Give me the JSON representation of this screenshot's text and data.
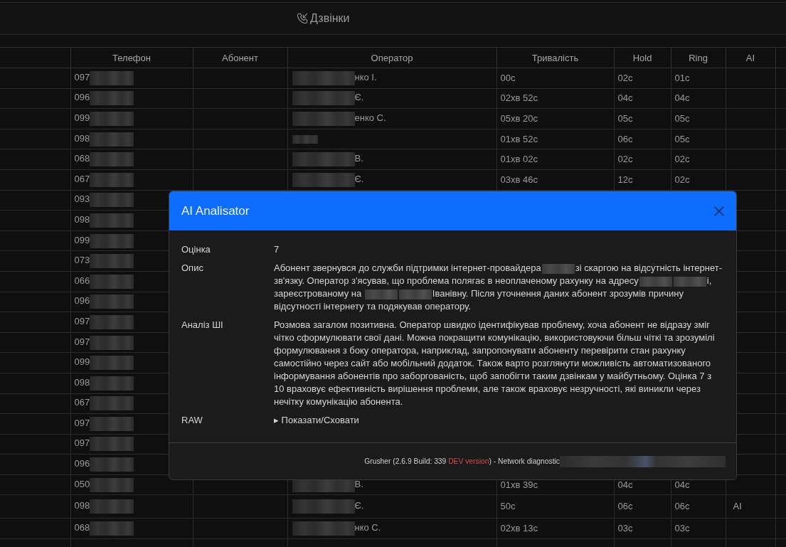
{
  "header": {
    "title": "Дзвінки"
  },
  "table": {
    "columns": [
      "Телефон",
      "Абонент",
      "Оператор",
      "Тривалість",
      "Hold",
      "Ring",
      "AI"
    ],
    "rows": [
      {
        "phone": "097",
        "phone_redacted": true,
        "operator": "нко І.",
        "operator_redacted": true,
        "duration": "00с",
        "hold": "02с",
        "ring": "01с"
      },
      {
        "phone": "096",
        "phone_redacted": true,
        "operator": "Є.",
        "operator_redacted": true,
        "duration": "02хв 52с",
        "hold": "04с",
        "ring": "04с"
      },
      {
        "phone": "099",
        "phone_redacted": true,
        "operator": "енко С.",
        "operator_redacted": true,
        "duration": "05хв 20с",
        "hold": "05с",
        "ring": "05с"
      },
      {
        "phone": "098",
        "phone_redacted": true,
        "operator_redacted": true,
        "duration": "01хв 52с",
        "hold": "06с",
        "ring": "05с"
      },
      {
        "phone": "068",
        "phone_redacted": true,
        "operator": "В.",
        "operator_redacted": true,
        "duration": "01хв 02с",
        "hold": "02с",
        "ring": "02с"
      },
      {
        "phone": "067",
        "phone_redacted": true,
        "operator": "Є.",
        "operator_redacted": true,
        "duration": "03хв 46с",
        "hold": "12с",
        "ring": "02с"
      },
      {
        "phone": "093",
        "phone_redacted": true
      },
      {
        "phone": "098",
        "phone_redacted": true
      },
      {
        "phone": "099",
        "phone_redacted": true
      },
      {
        "phone": "073",
        "phone_redacted": true
      },
      {
        "phone": "066",
        "phone_redacted": true
      },
      {
        "phone": "096",
        "phone_redacted": true
      },
      {
        "phone": "097",
        "phone_redacted": true
      },
      {
        "phone": "097",
        "phone_redacted": true
      },
      {
        "phone": "099",
        "phone_redacted": true
      },
      {
        "phone": "098",
        "phone_redacted": true
      },
      {
        "phone": "067",
        "phone_redacted": true
      },
      {
        "phone": "097",
        "phone_redacted": true
      },
      {
        "phone": "097",
        "phone_redacted": true
      },
      {
        "phone": "096",
        "phone_redacted": true
      },
      {
        "phone": "050",
        "phone_redacted": true,
        "operator": "В.",
        "operator_redacted": true,
        "duration": "01хв 39с",
        "hold": "04с",
        "ring": "04с"
      },
      {
        "phone": "098",
        "phone_redacted": true,
        "operator": "Є.",
        "operator_redacted": true,
        "duration": "50с",
        "hold": "06с",
        "ring": "06с",
        "ai": "AI"
      },
      {
        "phone": "068",
        "phone_redacted": true,
        "operator": "нко С.",
        "operator_redacted": true,
        "duration": "02хв 13с",
        "hold": "03с",
        "ring": "03с"
      }
    ]
  },
  "dialog": {
    "title": "AI Analisator",
    "fields": [
      {
        "label": "Оцінка",
        "kind": "text",
        "value": "7"
      },
      {
        "label": "Опис",
        "kind": "parts",
        "parts": [
          {
            "kind": "text",
            "text": "Абонент звернувся до служби підтримки інтернет-провайдера"
          },
          {
            "kind": "redacted"
          },
          {
            "kind": "text",
            "text": "зі скаргою на відсутність інтернет-зв'язку. Оператор з'ясував, що проблема полягає в неоплаченому рахунку на адресу"
          },
          {
            "kind": "redacted"
          },
          {
            "kind": "redacted"
          },
          {
            "kind": "text",
            "text": "і, зареєстрованому на "
          },
          {
            "kind": "redacted"
          },
          {
            "kind": "redacted"
          },
          {
            "kind": "text",
            "text": "Іванівну. Після уточнення даних абонент зрозумів причину відсутності інтернету та подякував оператору."
          }
        ]
      },
      {
        "label": "Аналіз ШІ",
        "kind": "text",
        "value": "Розмова загалом позитивна. Оператор швидко ідентифікував проблему, хоча абонент не відразу зміг чітко сформулювати свої дані. Можна покращити комунікацію, використовуючи більш чіткі та зрозумілі формулювання з боку оператора, наприклад, запропонувати абоненту перевірити стан рахунку самостійно через сайт або мобільний додаток. Також варто розглянути можливість автоматизованого інформування абонентів про заборгованість, щоб запобігти таким дзвінкам у майбутньому. Оцінка 7 з 10 враховує ефективність вирішення проблеми, але також враховує незручності, які виникли через нечітку комунікацію абонента."
      },
      {
        "label": "RAW",
        "kind": "toggle",
        "value": "▸ Показати/Сховати"
      }
    ],
    "footer": {
      "parts": [
        {
          "kind": "plain",
          "text": "Grusher (2.6.9 Build: 339 "
        },
        {
          "kind": "dev",
          "text": "DEV version"
        },
        {
          "kind": "plain",
          "text": ") - Network diagnostic"
        }
      ],
      "redacted": true
    }
  }
}
